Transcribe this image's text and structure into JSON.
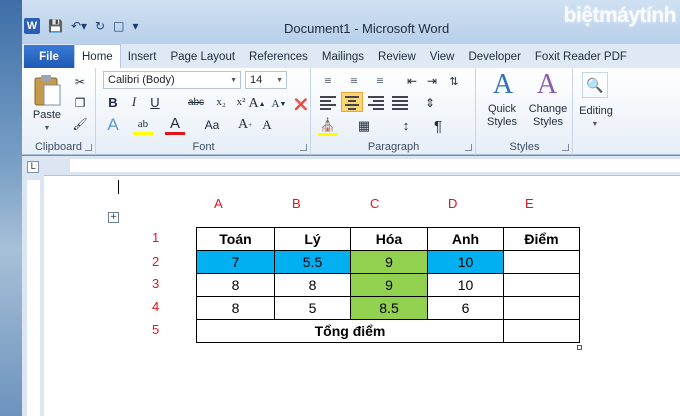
{
  "app": {
    "window_title": "Document1 - Microsoft Word",
    "logo_letter": "W",
    "brand_watermark": "biệtmáytính"
  },
  "tabs": [
    "File",
    "Home",
    "Insert",
    "Page Layout",
    "References",
    "Mailings",
    "Review",
    "View",
    "Developer",
    "Foxit Reader PDF"
  ],
  "active_tab": "Home",
  "ribbon": {
    "clipboard": {
      "label": "Clipboard",
      "paste": "Paste"
    },
    "font": {
      "label": "Font",
      "font_name": "Calibri (Body)",
      "font_size": "14",
      "bold": "B",
      "italic": "I",
      "underline": "U",
      "strike": "abc",
      "subscript": "x₂",
      "superscript": "x²",
      "grow": "A",
      "shrink": "A",
      "case": "Aa"
    },
    "paragraph": {
      "label": "Paragraph",
      "pilcrow": "¶"
    },
    "styles": {
      "label": "Styles",
      "quick_styles_1": "Quick",
      "quick_styles_2": "Styles",
      "change_styles_1": "Change",
      "change_styles_2": "Styles"
    },
    "editing": {
      "label": "Editing"
    }
  },
  "document": {
    "column_letters": [
      "A",
      "B",
      "C",
      "D",
      "E"
    ],
    "row_numbers": [
      "1",
      "2",
      "3",
      "4",
      "5"
    ],
    "table": {
      "headers": [
        "Toán",
        "Lý",
        "Hóa",
        "Anh",
        "Điểm"
      ],
      "rows": [
        [
          "7",
          "5.5",
          "9",
          "10",
          ""
        ],
        [
          "8",
          "8",
          "9",
          "10",
          ""
        ],
        [
          "8",
          "5",
          "8.5",
          "6",
          ""
        ]
      ],
      "total_label": "Tổng điểm"
    },
    "cell_colors": {
      "blue": "#00b0f0",
      "green": "#92d050"
    }
  }
}
